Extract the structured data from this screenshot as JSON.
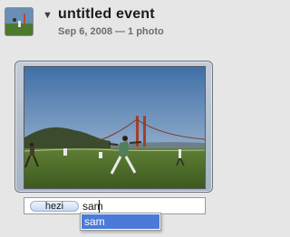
{
  "event": {
    "title": "untitled event",
    "date": "Sep 6, 2008",
    "separator": "—",
    "photo_count": "1 photo",
    "meta_line": "Sep 6, 2008 — 1 photo",
    "thumbnail_icon": "event-photo-thumbnail",
    "disclosure_icon": "disclosure-triangle-down-icon"
  },
  "photo": {
    "description_icon": "golden-gate-field-photo"
  },
  "tags": {
    "existing": [
      "hezi"
    ],
    "typed_text": "sam",
    "suggestions": [
      "sam"
    ],
    "selected_suggestion": "sam"
  },
  "colors": {
    "selection_highlight": "#4c7ad8",
    "token_fill": "#c9d8f1",
    "frame_fill": "#a7b3c3"
  }
}
